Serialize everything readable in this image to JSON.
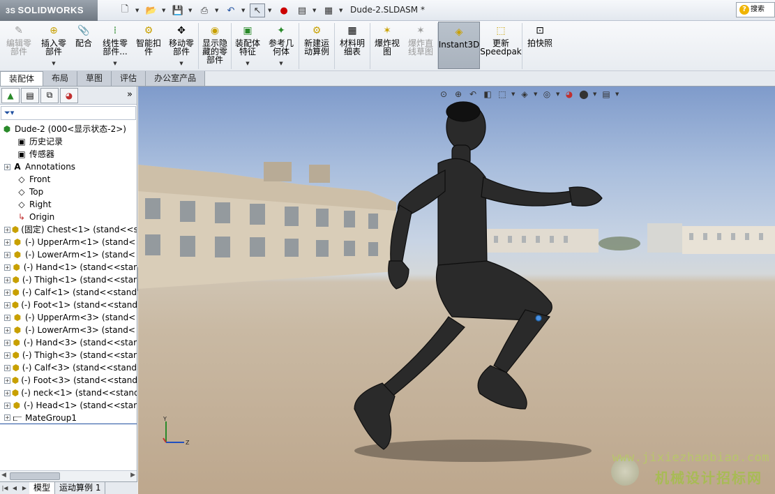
{
  "app": {
    "brand": "SOLIDWORKS",
    "brand_prefix": "3S",
    "document_title": "Dude-2.SLDASM *",
    "search_label": "搜索"
  },
  "quick_access": {
    "icons": [
      "new-icon",
      "open-icon",
      "save-icon",
      "print-icon",
      "undo-icon",
      "select-icon",
      "rebuild-icon",
      "file-properties-icon",
      "options-icon"
    ]
  },
  "ribbon": {
    "buttons": [
      {
        "label": "编辑零\n部件",
        "icon": "edit-component-icon",
        "disabled": true
      },
      {
        "label": "插入零\n部件",
        "icon": "insert-component-icon",
        "dropdown": true
      },
      {
        "label": "配合",
        "icon": "mate-icon"
      },
      {
        "label": "线性零\n部件...",
        "icon": "linear-pattern-icon",
        "dropdown": true
      },
      {
        "label": "智能扣\n件",
        "icon": "smart-fastener-icon"
      },
      {
        "label": "移动零\n部件",
        "icon": "move-component-icon",
        "dropdown": true
      },
      {
        "label": "显示隐\n藏的零\n部件",
        "icon": "show-hidden-icon"
      },
      {
        "label": "装配体\n特征",
        "icon": "assembly-feature-icon",
        "dropdown": true
      },
      {
        "label": "参考几\n何体",
        "icon": "reference-geometry-icon",
        "dropdown": true
      },
      {
        "label": "新建运\n动算例",
        "icon": "motion-study-icon"
      },
      {
        "label": "材料明\n细表",
        "icon": "bom-icon"
      },
      {
        "label": "爆炸视\n图",
        "icon": "exploded-view-icon"
      },
      {
        "label": "爆炸直\n线草图",
        "icon": "explode-line-sketch-icon",
        "disabled": true
      },
      {
        "label": "Instant3D",
        "icon": "instant3d-icon",
        "active": true
      },
      {
        "label": "更新\nSpeedpak",
        "icon": "speedpak-icon"
      },
      {
        "label": "拍快照",
        "icon": "snapshot-icon"
      }
    ]
  },
  "tabs": [
    "装配体",
    "布局",
    "草图",
    "评估",
    "办公室产品"
  ],
  "panel": {
    "tab_icons": [
      "feature-manager-icon",
      "property-manager-icon",
      "configuration-manager-icon",
      "display-manager-icon"
    ],
    "filter_icon": "filter-icon",
    "root": "Dude-2  (000<显示状态-2>)",
    "tree": [
      {
        "label": "历史记录",
        "icon": "history-icon",
        "expand": false
      },
      {
        "label": "传感器",
        "icon": "sensor-icon",
        "expand": false
      },
      {
        "label": "Annotations",
        "icon": "annotations-icon",
        "expand": true
      },
      {
        "label": "Front",
        "icon": "plane-icon",
        "expand": false
      },
      {
        "label": "Top",
        "icon": "plane-icon",
        "expand": false
      },
      {
        "label": "Right",
        "icon": "plane-icon",
        "expand": false
      },
      {
        "label": "Origin",
        "icon": "origin-icon",
        "expand": false
      },
      {
        "label": "(固定) Chest<1> (stand<<st",
        "icon": "part-icon",
        "expand": true
      },
      {
        "label": "(-) UpperArm<1> (stand<",
        "icon": "part-icon",
        "expand": true
      },
      {
        "label": "(-) LowerArm<1> (stand<",
        "icon": "part-icon",
        "expand": true
      },
      {
        "label": "(-) Hand<1> (stand<<star",
        "icon": "part-icon",
        "expand": true
      },
      {
        "label": "(-) Thigh<1> (stand<<star",
        "icon": "part-icon",
        "expand": true
      },
      {
        "label": "(-) Calf<1> (stand<<stand",
        "icon": "part-icon",
        "expand": true
      },
      {
        "label": "(-) Foot<1> (stand<<stand",
        "icon": "part-icon",
        "expand": true
      },
      {
        "label": "(-) UpperArm<3> (stand<",
        "icon": "part-icon",
        "expand": true
      },
      {
        "label": "(-) LowerArm<3> (stand<",
        "icon": "part-icon",
        "expand": true
      },
      {
        "label": "(-) Hand<3> (stand<<star",
        "icon": "part-icon",
        "expand": true
      },
      {
        "label": "(-) Thigh<3> (stand<<star",
        "icon": "part-icon",
        "expand": true
      },
      {
        "label": "(-) Calf<3> (stand<<stand",
        "icon": "part-icon",
        "expand": true
      },
      {
        "label": "(-) Foot<3> (stand<<stand",
        "icon": "part-icon",
        "expand": true
      },
      {
        "label": "(-) neck<1> (stand<<stand",
        "icon": "part-icon",
        "expand": true
      },
      {
        "label": "(-) Head<1> (stand<<star",
        "icon": "part-icon",
        "expand": true
      },
      {
        "label": "MateGroup1",
        "icon": "mate-group-icon",
        "expand": true
      }
    ],
    "bottom_tabs": [
      "模型",
      "运动算例 1"
    ]
  },
  "viewport": {
    "view_tools": [
      "zoom-to-fit-icon",
      "zoom-area-icon",
      "previous-view-icon",
      "section-view-icon",
      "view-orientation-icon",
      "display-style-icon",
      "hide-show-icon",
      "edit-appearance-icon",
      "apply-scene-icon",
      "view-settings-icon"
    ],
    "triad_axes": [
      "Y",
      "Z"
    ],
    "watermark_url": "www.jixiezhaobiao.com",
    "watermark_text": "机械设计招标网"
  },
  "colors": {
    "sky": "#8fa9d4",
    "ground": "#c2ad93",
    "figure": "#2a2a2a",
    "accent_blue": "#2050a0",
    "watermark": "#a8bb55"
  }
}
